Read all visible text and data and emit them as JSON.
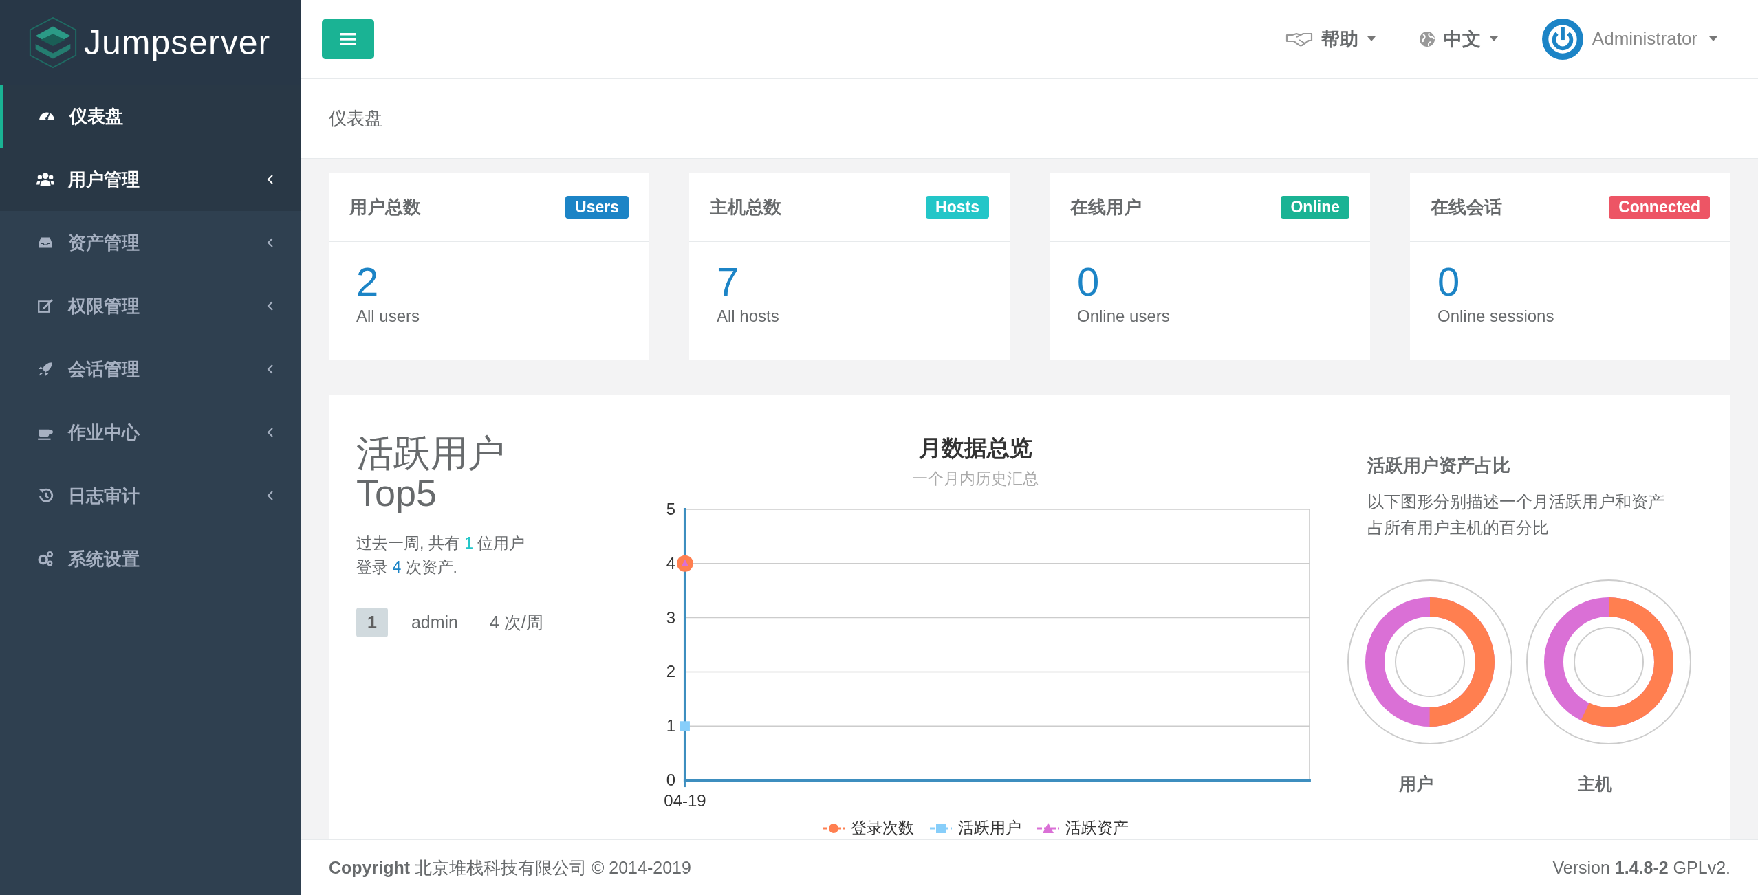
{
  "brand": {
    "name": "Jumpserver"
  },
  "sidebar": {
    "items": [
      {
        "label": "仪表盘",
        "selected": true,
        "highlighted": false,
        "has_submenu": false
      },
      {
        "label": "用户管理",
        "selected": false,
        "highlighted": true,
        "has_submenu": true
      },
      {
        "label": "资产管理",
        "selected": false,
        "highlighted": false,
        "has_submenu": true
      },
      {
        "label": "权限管理",
        "selected": false,
        "highlighted": false,
        "has_submenu": true
      },
      {
        "label": "会话管理",
        "selected": false,
        "highlighted": false,
        "has_submenu": true
      },
      {
        "label": "作业中心",
        "selected": false,
        "highlighted": false,
        "has_submenu": true
      },
      {
        "label": "日志审计",
        "selected": false,
        "highlighted": false,
        "has_submenu": true
      },
      {
        "label": "系统设置",
        "selected": false,
        "highlighted": false,
        "has_submenu": false
      }
    ]
  },
  "topbar": {
    "help": "帮助",
    "language": "中文",
    "user": "Administrator"
  },
  "breadcrumb": "仪表盘",
  "stat_cards": [
    {
      "title": "用户总数",
      "badge": "Users",
      "color": "#1c84c6",
      "value": "2",
      "caption": "All users"
    },
    {
      "title": "主机总数",
      "badge": "Hosts",
      "color": "#23c6c8",
      "value": "7",
      "caption": "All hosts"
    },
    {
      "title": "在线用户",
      "badge": "Online",
      "color": "#1ab394",
      "value": "0",
      "caption": "Online users"
    },
    {
      "title": "在线会话",
      "badge": "Connected",
      "color": "#ed5565",
      "value": "0",
      "caption": "Online sessions"
    }
  ],
  "top_users": {
    "title_lines": [
      "活跃用户",
      "Top5"
    ],
    "summary_lines": [
      "过去一周, 共有 **1** 位用户",
      "登录 **4** 次资产."
    ],
    "rows": [
      {
        "rank": "1",
        "name": "admin",
        "count": "4 次/周"
      }
    ]
  },
  "monthly": {
    "title": "月数据总览",
    "subtitle": "一个月内历史汇总",
    "chart_data": {
      "type": "line",
      "grid": true,
      "categories": [
        "04-19"
      ],
      "ylim": [
        0,
        5
      ],
      "yticks": [
        0,
        1,
        2,
        3,
        4,
        5
      ],
      "series": [
        {
          "name": "登录次数",
          "color": "#ff7f50",
          "marker": "circle",
          "values": [
            4
          ]
        },
        {
          "name": "活跃用户",
          "color": "#87cefa",
          "marker": "square",
          "values": [
            1
          ]
        },
        {
          "name": "活跃资产",
          "color": "#da70d6",
          "marker": "triangle",
          "values": [
            4
          ]
        }
      ]
    }
  },
  "ratio": {
    "title": "活跃用户资产占比",
    "description": "以下图形分别描述一个月活跃用户和资产占所有用户主机的百分比",
    "donuts": [
      {
        "label": "用户"
      },
      {
        "label": "主机"
      }
    ]
  },
  "footer": {
    "copyright": "**Copyright** 北京堆栈科技有限公司 © 2014-2019",
    "version": "Version **1.4.8-2** GPLv2."
  }
}
